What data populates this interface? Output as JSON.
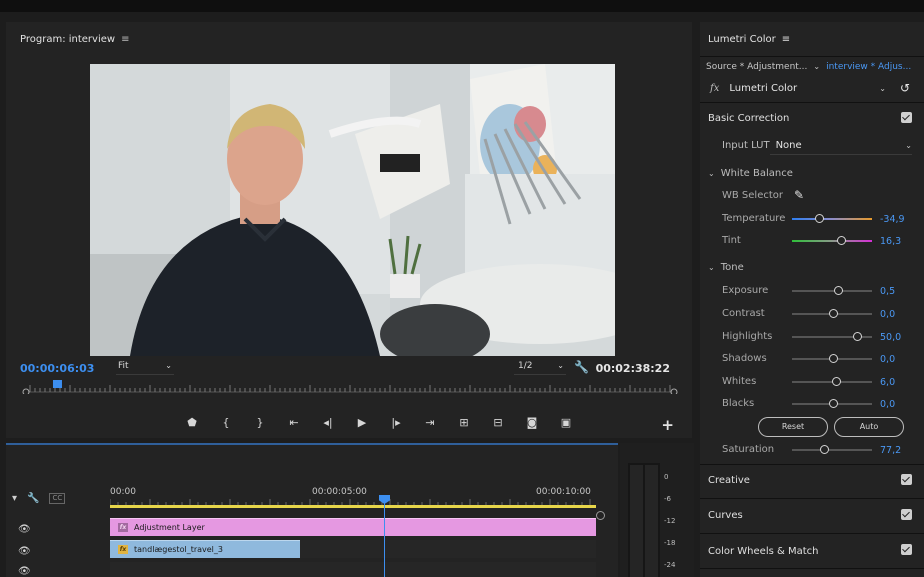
{
  "program_monitor": {
    "title": "Program: interview",
    "menu_glyph": "≡",
    "current_timecode": "00:00:06:03",
    "fit_label": "Fit",
    "resolution_label": "1/2",
    "duration_timecode": "00:02:38:22",
    "transport_icons": [
      "marker-icon",
      "in-point-icon",
      "out-point-icon",
      "go-to-in-icon",
      "step-back-icon",
      "play-icon",
      "step-forward-icon",
      "go-to-out-icon",
      "lift-icon",
      "extract-icon",
      "export-frame-icon",
      "comparison-view-icon"
    ],
    "playhead_fraction": 0.045
  },
  "timeline": {
    "time_labels": [
      "00:00",
      "00:00:05:00",
      "00:00:10:00"
    ],
    "clips": {
      "adjustment": "Adjustment Layer",
      "video": "tandlægestol_travel_3"
    },
    "playhead_time": "00:00:06:03"
  },
  "audio_meter": {
    "ticks": [
      "0",
      "-6",
      "-12",
      "-18",
      "-24"
    ]
  },
  "lumetri": {
    "title": "Lumetri Color",
    "menu_glyph": "≡",
    "source_label": "Source * Adjustment...",
    "target_label": "interview * Adjus...",
    "fx_prefix": "fx",
    "effect_name": "Lumetri Color",
    "basic_correction": "Basic Correction",
    "input_lut_label": "Input LUT",
    "input_lut_value": "None",
    "white_balance": "White Balance",
    "wb_selector": "WB Selector",
    "temperature": {
      "label": "Temperature",
      "value": "-34,9",
      "knob": 0.34
    },
    "tint": {
      "label": "Tint",
      "value": "16,3",
      "knob": 0.62
    },
    "tone": "Tone",
    "exposure": {
      "label": "Exposure",
      "value": "0,5",
      "knob": 0.58
    },
    "contrast": {
      "label": "Contrast",
      "value": "0,0",
      "knob": 0.52
    },
    "highlights": {
      "label": "Highlights",
      "value": "50,0",
      "knob": 0.82
    },
    "shadows": {
      "label": "Shadows",
      "value": "0,0",
      "knob": 0.52
    },
    "whites": {
      "label": "Whites",
      "value": "6,0",
      "knob": 0.55
    },
    "blacks": {
      "label": "Blacks",
      "value": "0,0",
      "knob": 0.52
    },
    "reset_label": "Reset",
    "auto_label": "Auto",
    "saturation": {
      "label": "Saturation",
      "value": "77,2",
      "knob": 0.4
    },
    "creative": "Creative",
    "curves": "Curves",
    "color_wheels": "Color Wheels & Match"
  },
  "colors": {
    "accent": "#3d8ff0",
    "value_blue": "#4a97f2",
    "adjustment_clip": "#e598e1",
    "video_clip": "#8fb9dd",
    "work_area": "#e7d64a"
  }
}
